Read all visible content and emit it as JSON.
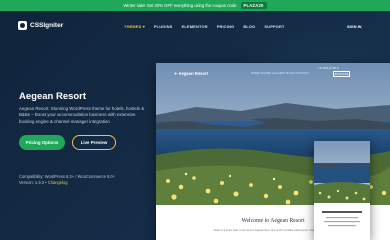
{
  "promo": {
    "text": "Winter sale! Get 20% OFF everything using the coupon code:",
    "code": "PLAZA20"
  },
  "brand": {
    "name": "CSSIgniter"
  },
  "nav": {
    "items": [
      {
        "label": "THEMES ▾",
        "active": true
      },
      {
        "label": "PLUGINS",
        "active": false
      },
      {
        "label": "ELEMENTOR",
        "active": false
      },
      {
        "label": "PRICING",
        "active": false
      },
      {
        "label": "BLOG",
        "active": false
      },
      {
        "label": "SUPPORT",
        "active": false
      }
    ],
    "signin": "SIGN IN"
  },
  "hero": {
    "title": "Aegean Resort",
    "description": "Aegean Resort: Stunning WordPress theme for hotels, hostels & B&Bs – Boost your accommodation business with extensive booking engine & channel manager integration",
    "primary_button": "Pricing Options",
    "secondary_button": "Live Preview",
    "compat_prefix": "Compatibility: WordPress 6.3+ / WooCommerce 6.0+",
    "version_prefix": "Version: 1.9.3 • ",
    "changelog": "Changelog"
  },
  "preview": {
    "logo": "✦ Aegean Resort",
    "nav_links": "HOME   ROOMS   GALLERY   BLOG   CONTACT",
    "top_info": "+30 2289 00 000   ✉",
    "book_button": "BOOK NOW",
    "heading": "Welcome to Aegean Resort",
    "body_text": "Relax in a hotel, back to the sound. Aegean Sea, One of the Cycladic island group. Close to the sea level, experience"
  },
  "colors": {
    "accent_green": "#1fa85a",
    "accent_gold": "#f2c14a",
    "hero_bg": "#10243b"
  }
}
